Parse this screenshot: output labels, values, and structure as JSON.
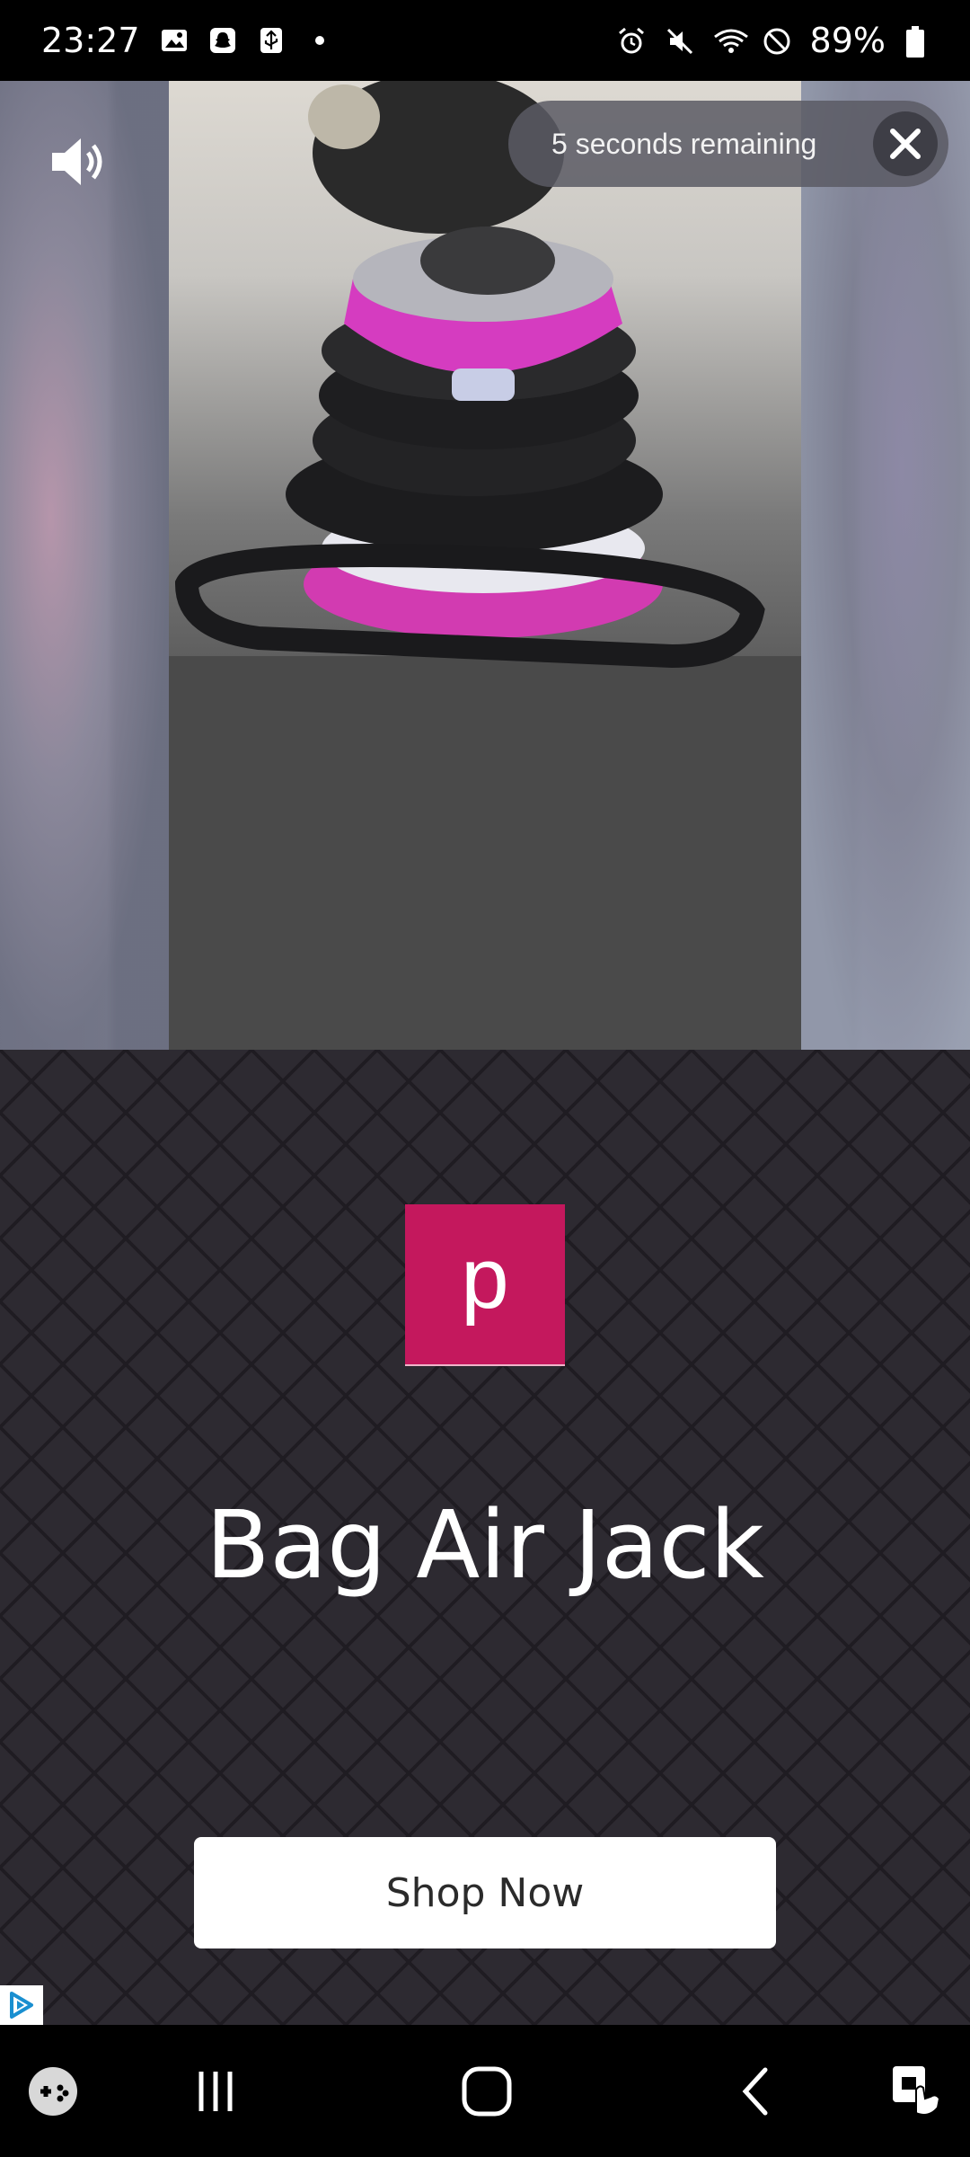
{
  "status_bar": {
    "time": "23:27",
    "left_icons": [
      "image-icon",
      "snapchat-icon",
      "usb-debug-icon",
      "dot-icon"
    ],
    "right_icons": [
      "alarm-icon",
      "mute-icon",
      "wifi-icon",
      "do-not-disturb-icon",
      "battery-icon"
    ],
    "battery_percent": "89%"
  },
  "video": {
    "mute_icon": "volume-icon",
    "timer_text": "5 seconds remaining",
    "close_icon": "close-icon"
  },
  "ad": {
    "logo_letter": "p",
    "logo_color": "#c4185d",
    "headline": "Bag Air Jack",
    "cta_label": "Shop Now",
    "adchoices_icon": "adchoices-icon"
  },
  "nav_bar": {
    "items": [
      "game-tools-icon",
      "recent-apps-icon",
      "home-icon",
      "back-icon",
      "accessibility-icon"
    ]
  }
}
